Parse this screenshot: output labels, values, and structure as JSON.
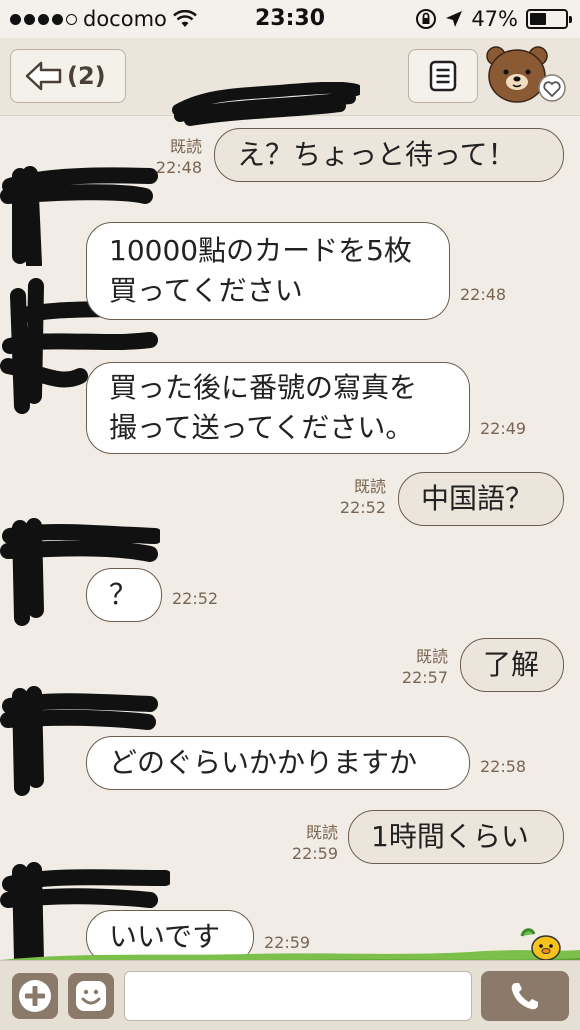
{
  "status": {
    "carrier": "docomo",
    "time": "23:30",
    "battery": "47%",
    "battery_level": 0.47
  },
  "header": {
    "unread": "(2)"
  },
  "messages": [
    {
      "side": "sent",
      "lines": [
        "え？ちょっと待って！"
      ],
      "read": "既読",
      "time": "22:48"
    },
    {
      "side": "recv",
      "lines": [
        "10000點のカードを5枚",
        "買ってください"
      ],
      "time": "22:48"
    },
    {
      "side": "recv",
      "lines": [
        "買った後に番號の寫真を",
        "撮って送ってください。"
      ],
      "time": "22:49"
    },
    {
      "side": "sent",
      "lines": [
        "中国語？"
      ],
      "read": "既読",
      "time": "22:52"
    },
    {
      "side": "recv",
      "lines": [
        "？"
      ],
      "time": "22:52"
    },
    {
      "side": "sent",
      "lines": [
        "了解"
      ],
      "read": "既読",
      "time": "22:57"
    },
    {
      "side": "recv",
      "lines": [
        "どのぐらいかかりますか"
      ],
      "time": "22:58"
    },
    {
      "side": "sent",
      "lines": [
        "1時間くらい"
      ],
      "read": "既読",
      "time": "22:59"
    },
    {
      "side": "recv",
      "lines": [
        "いいです"
      ],
      "time": "22:59"
    }
  ],
  "composer": {
    "value": "",
    "placeholder": ""
  },
  "icons": {
    "back": "back-arrow-icon",
    "menu": "list-icon",
    "sticker": "bear-icon",
    "plus": "plus-icon",
    "emoji": "smiley-icon",
    "call": "phone-icon"
  },
  "colors": {
    "bubble_border": "#6d5e50",
    "sent_bubble": "#ece5db",
    "recv_bubble": "#ffffff",
    "meta_text": "#7a6552",
    "accent_button": "#8b7a6a"
  }
}
